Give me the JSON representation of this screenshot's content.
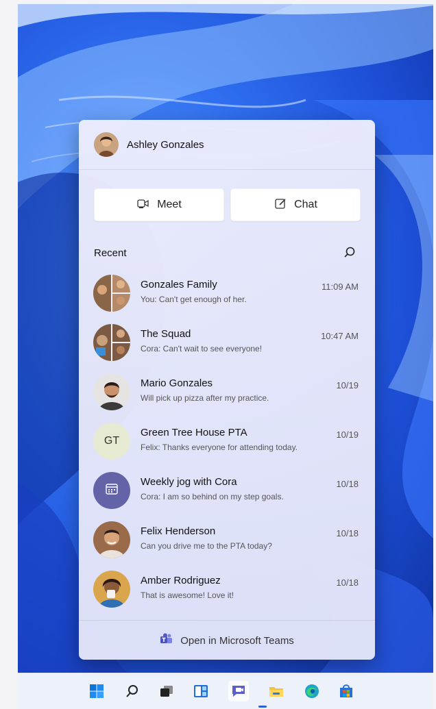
{
  "user": {
    "name": "Ashley Gonzales"
  },
  "actions": {
    "meet_label": "Meet",
    "chat_label": "Chat"
  },
  "recent": {
    "label": "Recent",
    "items": [
      {
        "name": "Gonzales Family",
        "preview": "You: Can't get enough of her.",
        "time": "11:09 AM",
        "avatar": "group-photo"
      },
      {
        "name": "The Squad",
        "preview": "Cora: Can't wait to see everyone!",
        "time": "10:47 AM",
        "avatar": "group-photo"
      },
      {
        "name": "Mario Gonzales",
        "preview": "Will pick up pizza after my practice.",
        "time": "10/19",
        "avatar": "person-photo"
      },
      {
        "name": "Green Tree House PTA",
        "preview": "Felix: Thanks everyone for attending today.",
        "time": "10/19",
        "avatar": "initials",
        "initials": "GT"
      },
      {
        "name": "Weekly jog with Cora",
        "preview": "Cora: I am so behind on my step goals.",
        "time": "10/18",
        "avatar": "calendar-icon"
      },
      {
        "name": "Felix Henderson",
        "preview": "Can you drive me to the PTA today?",
        "time": "10/18",
        "avatar": "person-photo"
      },
      {
        "name": "Amber Rodriguez",
        "preview": "That is awesome! Love it!",
        "time": "10/18",
        "avatar": "person-photo"
      }
    ]
  },
  "footer": {
    "label": "Open in Microsoft Teams"
  },
  "taskbar": {
    "icons": [
      "start-icon",
      "search-icon",
      "task-view-icon",
      "widgets-icon",
      "teams-chat-icon",
      "file-explorer-icon",
      "edge-icon",
      "store-icon"
    ],
    "active": "teams-chat-icon"
  },
  "colors": {
    "accent": "#5b5fc7",
    "wallpaper": "#1d4fd6"
  }
}
